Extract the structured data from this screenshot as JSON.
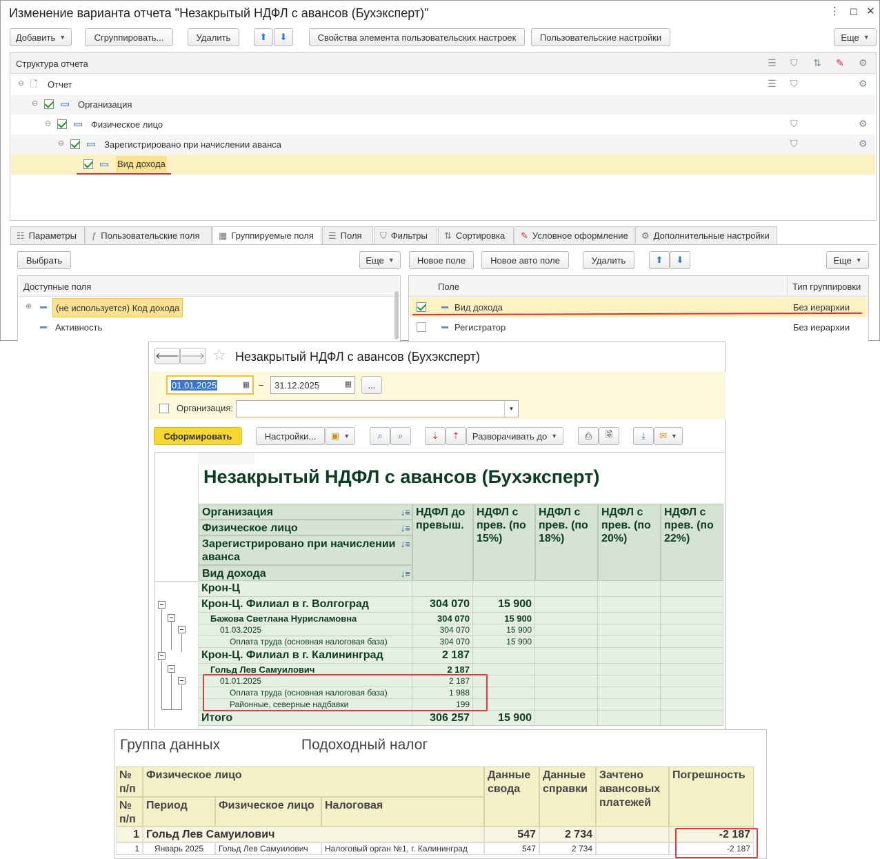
{
  "window1": {
    "title": "Изменение варианта отчета \"Незакрытый НДФЛ с авансов (Бухэксперт)\"",
    "toolbar": {
      "add": "Добавить",
      "group": "Сгруппировать...",
      "delete": "Удалить",
      "element_props": "Свойства элемента пользовательских настроек",
      "user_settings": "Пользовательские настройки",
      "more": "Еще"
    },
    "structure": {
      "header": "Структура отчета",
      "items": [
        {
          "label": "Отчет"
        },
        {
          "label": "Организация"
        },
        {
          "label": "Физическое лицо"
        },
        {
          "label": "Зарегистрировано при начислении аванса"
        },
        {
          "label": "Вид дохода"
        }
      ]
    },
    "tabs": [
      "Параметры",
      "Пользовательские поля",
      "Группируемые поля",
      "Поля",
      "Фильтры",
      "Сортировка",
      "Условное оформление",
      "Дополнительные настройки"
    ],
    "left_panel": {
      "select": "Выбрать",
      "more": "Еще",
      "header": "Доступные поля",
      "items": [
        "(не используется) Код дохода",
        "Активность"
      ]
    },
    "right_panel": {
      "new_field": "Новое поле",
      "new_auto_field": "Новое авто поле",
      "delete": "Удалить",
      "more": "Еще",
      "col_field": "Поле",
      "col_group_type": "Тип группировки",
      "rows": [
        {
          "field": "Вид дохода",
          "type": "Без иерархии",
          "checked": true
        },
        {
          "field": "Регистратор",
          "type": "Без иерархии",
          "checked": false
        }
      ]
    }
  },
  "window2": {
    "title": "Незакрытый НДФЛ с авансов (Бухэксперт)",
    "date_from": "01.01.2025",
    "date_sep": "–",
    "date_to": "31.12.2025",
    "ellipsis": "...",
    "org_label": "Организация:",
    "generate": "Сформировать",
    "settings": "Настройки...",
    "expand_to": "Разворачивать до",
    "report_title": "Незакрытый НДФЛ с авансов (Бухэксперт)",
    "group_headers": [
      "Организация",
      "Физическое лицо",
      "Зарегистрировано при начислении аванса",
      "Вид дохода"
    ],
    "col_headers": [
      "НДФЛ до превыш.",
      "НДФЛ с прев. (по 15%)",
      "НДФЛ с прев. (по 18%)",
      "НДФЛ с прев. (по 20%)",
      "НДФЛ с прев. (по 22%)"
    ],
    "rows": [
      {
        "label": "Крон-Ц",
        "c1": "",
        "c2": ""
      },
      {
        "label": "Крон-Ц. Филиал в г. Волгоград",
        "c1": "304 070",
        "c2": "15 900"
      },
      {
        "label": "Бажова Светлана Нурисламовна",
        "c1": "304 070",
        "c2": "15 900"
      },
      {
        "label": "01.03.2025",
        "c1": "304 070",
        "c2": "15 900"
      },
      {
        "label": "Оплата труда (основная налоговая база)",
        "c1": "304 070",
        "c2": "15 900"
      },
      {
        "label": "Крон-Ц. Филиал в г. Калининград",
        "c1": "2 187",
        "c2": ""
      },
      {
        "label": "Гольд Лев Самуилович",
        "c1": "2 187",
        "c2": ""
      },
      {
        "label": "01.01.2025",
        "c1": "2 187",
        "c2": ""
      },
      {
        "label": "Оплата труда (основная налоговая база)",
        "c1": "1 988",
        "c2": ""
      },
      {
        "label": "Районные, северные надбавки",
        "c1": "199",
        "c2": ""
      },
      {
        "label": "Итого",
        "c1": "306 257",
        "c2": "15 900"
      }
    ]
  },
  "window3": {
    "group_label": "Группа данных",
    "group_value": "Подоходный налог",
    "headers": {
      "num": "№ п/п",
      "person": "Физическое лицо",
      "summary": "Данные свода",
      "certificate": "Данные справки",
      "credited": "Зачтено авансовых платежей",
      "error": "Погрешность",
      "num2": "№ п/п",
      "period": "Период",
      "person2": "Физическое лицо",
      "tax": "Налоговая"
    },
    "group_row": {
      "num": "1",
      "person": "Гольд Лев Самуилович",
      "summary": "547",
      "certificate": "2 734",
      "credited": "",
      "error": "-2 187"
    },
    "detail_row": {
      "num": "1",
      "period": "Январь 2025",
      "person": "Гольд Лев Самуилович",
      "tax": "Налоговый орган №1, г. Калининград",
      "summary": "547",
      "certificate": "2 734",
      "credited": "",
      "error": "-2 187"
    }
  }
}
